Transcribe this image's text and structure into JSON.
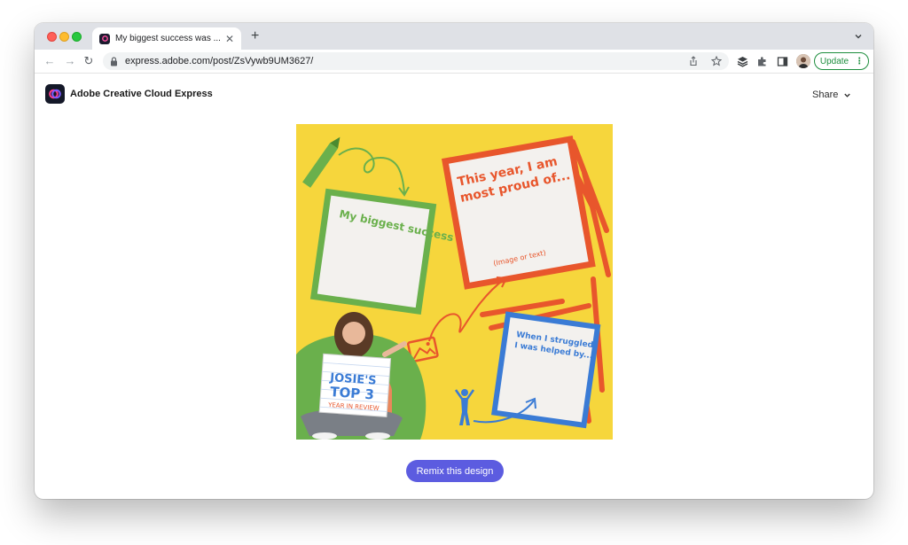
{
  "browser": {
    "tab": {
      "title": "My biggest success was ... - Adobe Creative Cloud Express",
      "close_glyph": "✕",
      "favicon": "adobe-express-icon"
    },
    "new_tab_glyph": "+",
    "address_bar": {
      "url": "express.adobe.com/post/ZsVywb9UM3627/"
    },
    "update_button": {
      "label": "Update",
      "menu_glyph": "⋮"
    },
    "nav": {
      "back_glyph": "←",
      "forward_glyph": "→",
      "reload_glyph": "↻"
    },
    "traffic_lights": {
      "close": "#ff5f57",
      "minimize": "#febc2e",
      "zoom": "#28c840"
    }
  },
  "header": {
    "app_name": "Adobe Creative Cloud Express",
    "share_label": "Share"
  },
  "design": {
    "background_color": "#f6d63c",
    "card_green": {
      "text": "My biggest success was ..."
    },
    "card_orange": {
      "heading_line1": "This year, I am",
      "heading_line2": "most proud of...",
      "hint": "(Image or text)"
    },
    "card_blue": {
      "line1": "When I struggled,",
      "line2": "I was helped by..."
    },
    "sign": {
      "line1": "JOSIE'S",
      "line2": "TOP 3",
      "line3": "YEAR IN REVIEW"
    }
  },
  "actions": {
    "remix_label": "Remix this design"
  },
  "colors": {
    "accent": "#5c5ce0",
    "green": "#6ab04c",
    "orange": "#e8562c",
    "blue": "#3a7bd5",
    "yellow": "#f6d63c"
  }
}
